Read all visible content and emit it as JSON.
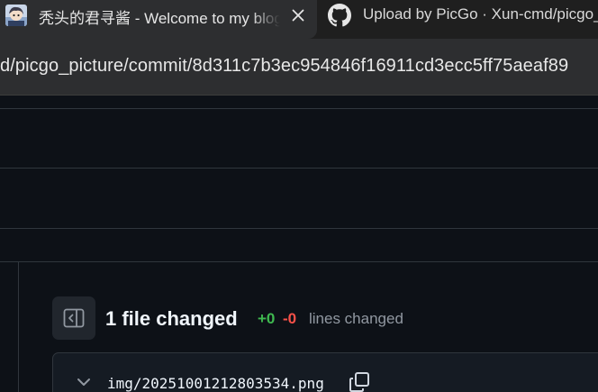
{
  "browser": {
    "tabs": [
      {
        "title": "秃头的君寻酱 - Welcome to my blog",
        "favicon": "avatar-favicon",
        "active": true
      },
      {
        "title": "Upload by PicGo · Xun-cmd/picgo_picture",
        "favicon": "github-favicon",
        "active": false
      }
    ],
    "address_bar": {
      "url": "d/picgo_picture/commit/8d311c7b3ec954846f16911cd3ecc5ff75aeaf89"
    }
  },
  "diff_summary": {
    "toggle_icon": "sidebar-toggle-icon",
    "files_changed": "1 file changed",
    "additions": "+0",
    "deletions": "-0",
    "lines_changed": "lines changed"
  },
  "file": {
    "name": "img/20251001212803534.png",
    "icons": [
      "chevron-down-icon",
      "copy-icon"
    ]
  },
  "colors": {
    "page_background": "#0d1117",
    "additions": "#3fb950",
    "deletions": "#f85149",
    "border": "#30363d"
  }
}
